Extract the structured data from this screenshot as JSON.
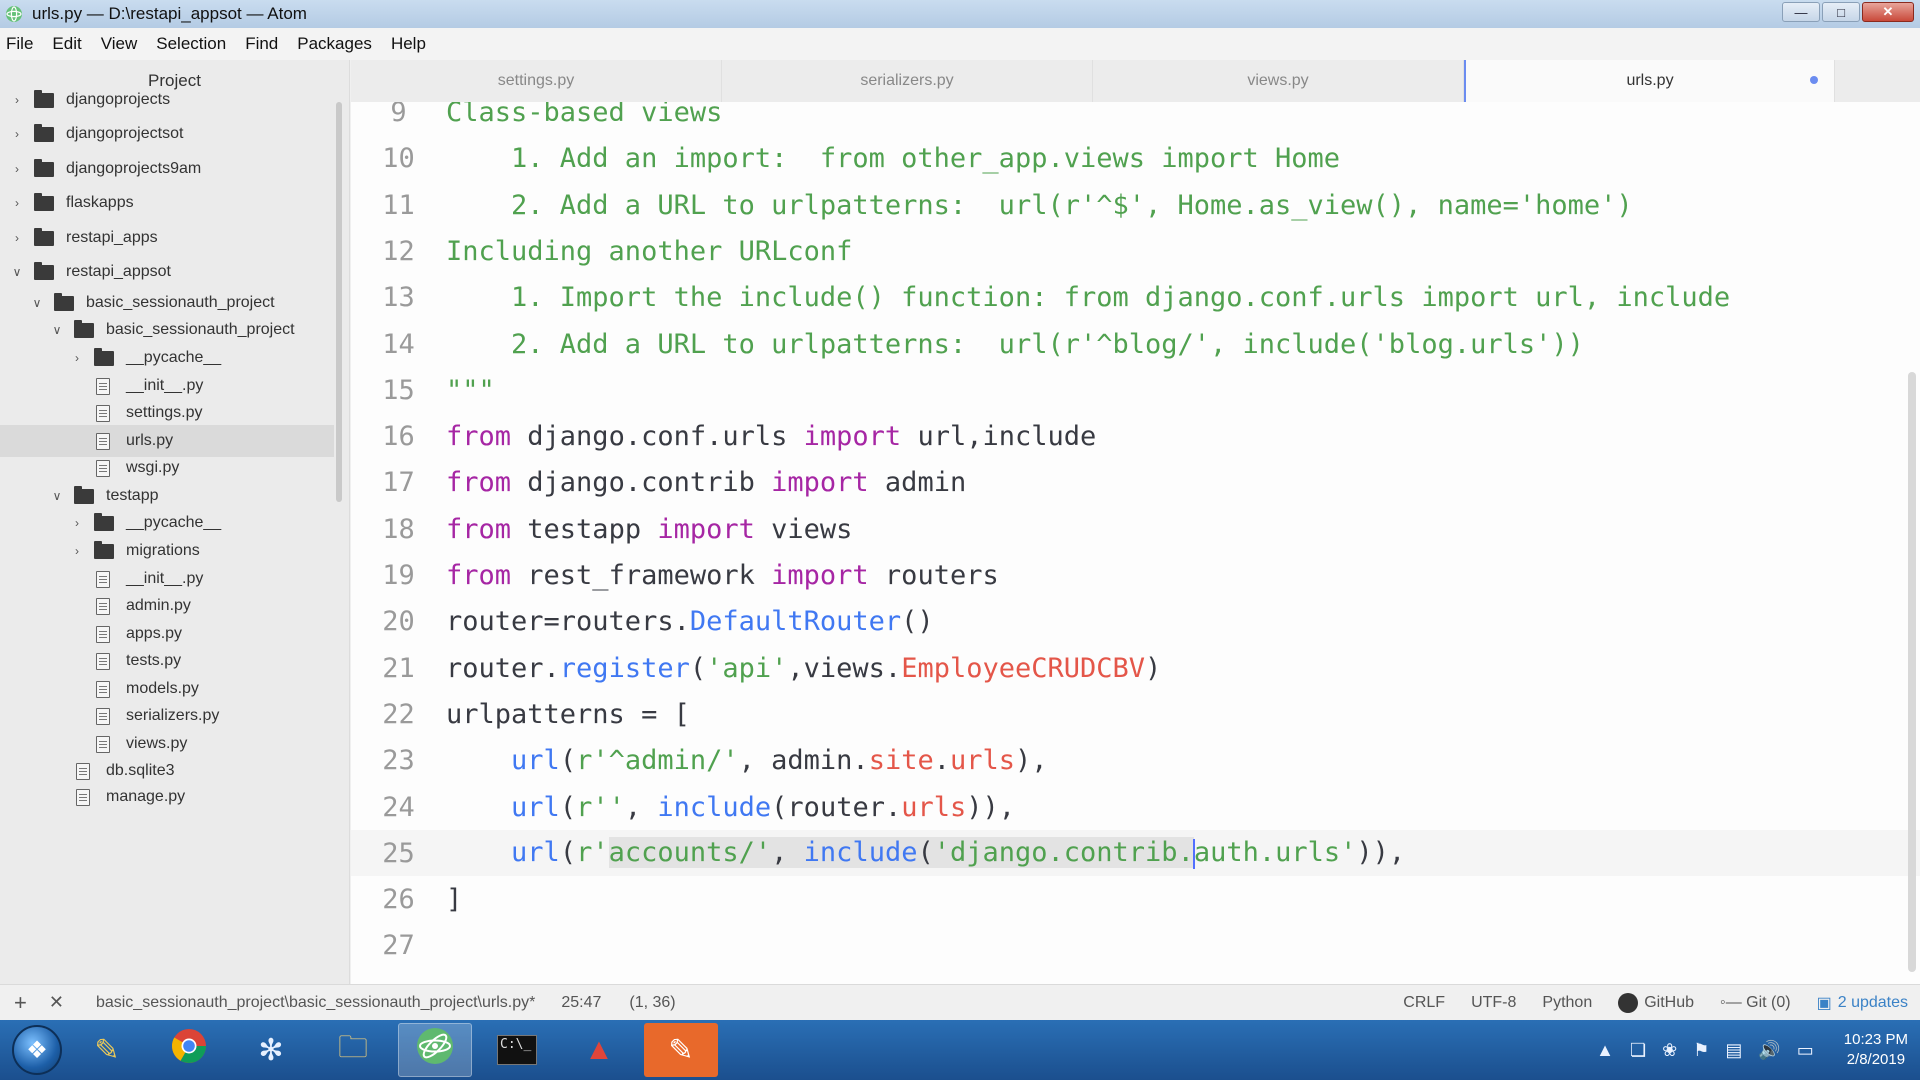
{
  "window": {
    "title": "urls.py — D:\\restapi_appsot — Atom",
    "controls": [
      "minimize",
      "maximize",
      "close"
    ]
  },
  "menu": [
    "File",
    "Edit",
    "View",
    "Selection",
    "Find",
    "Packages",
    "Help"
  ],
  "sidebar": {
    "header": "Project",
    "items": [
      {
        "label": "djangoprojects",
        "type": "folder",
        "expanded": false,
        "depth": 0
      },
      {
        "label": "djangoprojectsot",
        "type": "folder",
        "expanded": false,
        "depth": 0
      },
      {
        "label": "djangoprojects9am",
        "type": "folder",
        "expanded": false,
        "depth": 0
      },
      {
        "label": "flaskapps",
        "type": "folder",
        "expanded": false,
        "depth": 0
      },
      {
        "label": "restapi_apps",
        "type": "folder",
        "expanded": false,
        "depth": 0
      },
      {
        "label": "restapi_appsot",
        "type": "folder",
        "expanded": true,
        "depth": 0
      },
      {
        "label": "basic_sessionauth_project",
        "type": "folder",
        "expanded": true,
        "depth": 1
      },
      {
        "label": "basic_sessionauth_project",
        "type": "folder",
        "expanded": true,
        "depth": 2
      },
      {
        "label": "__pycache__",
        "type": "folder",
        "expanded": false,
        "depth": 3
      },
      {
        "label": "__init__.py",
        "type": "file",
        "depth": 3
      },
      {
        "label": "settings.py",
        "type": "file",
        "depth": 3
      },
      {
        "label": "urls.py",
        "type": "file",
        "depth": 3,
        "selected": true
      },
      {
        "label": "wsgi.py",
        "type": "file",
        "depth": 3
      },
      {
        "label": "testapp",
        "type": "folder",
        "expanded": true,
        "depth": 2
      },
      {
        "label": "__pycache__",
        "type": "folder",
        "expanded": false,
        "depth": 3
      },
      {
        "label": "migrations",
        "type": "folder",
        "expanded": false,
        "depth": 3
      },
      {
        "label": "__init__.py",
        "type": "file",
        "depth": 3
      },
      {
        "label": "admin.py",
        "type": "file",
        "depth": 3
      },
      {
        "label": "apps.py",
        "type": "file",
        "depth": 3
      },
      {
        "label": "tests.py",
        "type": "file",
        "depth": 3
      },
      {
        "label": "models.py",
        "type": "file",
        "depth": 3
      },
      {
        "label": "serializers.py",
        "type": "file",
        "depth": 3
      },
      {
        "label": "views.py",
        "type": "file",
        "depth": 3
      },
      {
        "label": "db.sqlite3",
        "type": "file",
        "depth": 2
      },
      {
        "label": "manage.py",
        "type": "file",
        "depth": 2
      }
    ]
  },
  "tabs": [
    {
      "label": "settings.py",
      "active": false
    },
    {
      "label": "serializers.py",
      "active": false
    },
    {
      "label": "views.py",
      "active": false
    },
    {
      "label": "urls.py",
      "active": true,
      "modified": true
    }
  ],
  "editor": {
    "cursor_line": 25,
    "lines": [
      {
        "num": "9",
        "tokens": [
          [
            "Class-based views",
            "cm"
          ]
        ]
      },
      {
        "num": "10",
        "tokens": [
          [
            "    1. Add an import:  from other_app.views import Home",
            "cm"
          ]
        ]
      },
      {
        "num": "11",
        "tokens": [
          [
            "    2. Add a URL to urlpatterns:  url(r'^$', Home.as_view(), name='home')",
            "cm"
          ]
        ]
      },
      {
        "num": "12",
        "tokens": [
          [
            "Including another URLconf",
            "cm"
          ]
        ]
      },
      {
        "num": "13",
        "tokens": [
          [
            "    1. Import the include() function: from django.conf.urls import url, include",
            "cm"
          ]
        ]
      },
      {
        "num": "14",
        "tokens": [
          [
            "    2. Add a URL to urlpatterns:  url(r'^blog/', include('blog.urls'))",
            "cm"
          ]
        ]
      },
      {
        "num": "15",
        "tokens": [
          [
            "\"\"\"",
            "cm"
          ]
        ]
      },
      {
        "num": "16",
        "tokens": [
          [
            "from",
            "kw"
          ],
          [
            " django.conf.urls ",
            ""
          ],
          [
            "import",
            "kw"
          ],
          [
            " url,include",
            ""
          ]
        ]
      },
      {
        "num": "17",
        "tokens": [
          [
            "from",
            "kw"
          ],
          [
            " django.contrib ",
            ""
          ],
          [
            "import",
            "kw"
          ],
          [
            " admin",
            ""
          ]
        ]
      },
      {
        "num": "18",
        "tokens": [
          [
            "from",
            "kw"
          ],
          [
            " testapp ",
            ""
          ],
          [
            "import",
            "kw"
          ],
          [
            " views",
            ""
          ]
        ]
      },
      {
        "num": "19",
        "tokens": [
          [
            "from",
            "kw"
          ],
          [
            " rest_framework ",
            ""
          ],
          [
            "import",
            "kw"
          ],
          [
            " routers",
            ""
          ]
        ]
      },
      {
        "num": "20",
        "tokens": [
          [
            "router=routers.",
            ""
          ],
          [
            "DefaultRouter",
            "fn"
          ],
          [
            "()",
            ""
          ]
        ]
      },
      {
        "num": "21",
        "tokens": [
          [
            "router.",
            ""
          ],
          [
            "register",
            "fn"
          ],
          [
            "(",
            ""
          ],
          [
            "'api'",
            "str"
          ],
          [
            ",views.",
            ""
          ],
          [
            "EmployeeCRUDCBV",
            "cls"
          ],
          [
            ")",
            ""
          ]
        ]
      },
      {
        "num": "22",
        "tokens": [
          [
            "urlpatterns = [",
            ""
          ]
        ]
      },
      {
        "num": "23",
        "tokens": [
          [
            "    ",
            ""
          ],
          [
            "url",
            "fn"
          ],
          [
            "(",
            ""
          ],
          [
            "r'^admin/'",
            "str"
          ],
          [
            ", admin.",
            ""
          ],
          [
            "site",
            "cls"
          ],
          [
            ".",
            ""
          ],
          [
            "urls",
            "cls"
          ],
          [
            "),",
            ""
          ]
        ]
      },
      {
        "num": "24",
        "tokens": [
          [
            "    ",
            ""
          ],
          [
            "url",
            "fn"
          ],
          [
            "(",
            ""
          ],
          [
            "r''",
            "str"
          ],
          [
            ", ",
            ""
          ],
          [
            "include",
            "fn"
          ],
          [
            "(router.",
            ""
          ],
          [
            "urls",
            "cls"
          ],
          [
            ")),",
            ""
          ]
        ]
      },
      {
        "num": "25",
        "tokens": [
          [
            "    ",
            ""
          ],
          [
            "url",
            "fn"
          ],
          [
            "(",
            ""
          ],
          [
            "r'",
            "str"
          ],
          [
            "accounts/'",
            "str sel"
          ],
          [
            ", ",
            "sel"
          ],
          [
            "include",
            "fn sel"
          ],
          [
            "(",
            "sel"
          ],
          [
            "'django.contrib.",
            "str sel"
          ],
          [
            "|",
            "caret"
          ],
          [
            "auth.urls'",
            "str"
          ],
          [
            ")),",
            ""
          ]
        ]
      },
      {
        "num": "26",
        "tokens": [
          [
            "]",
            ""
          ]
        ]
      },
      {
        "num": "27",
        "tokens": [
          [
            "",
            ""
          ]
        ]
      }
    ]
  },
  "status": {
    "path": "basic_sessionauth_project\\basic_sessionauth_project\\urls.py*",
    "position": "25:47",
    "selection": "(1, 36)",
    "line_ending": "CRLF",
    "encoding": "UTF-8",
    "grammar": "Python",
    "github": "GitHub",
    "git": "Git (0)",
    "updates": "2 updates"
  },
  "taskbar": {
    "apps": [
      "paint-brush-app",
      "chrome",
      "settings-gear-app",
      "file-explorer",
      "atom",
      "command-prompt",
      "red-app",
      "orange-app"
    ],
    "active_app": "atom",
    "clock_time": "10:23 PM",
    "clock_date": "2/8/2019"
  }
}
